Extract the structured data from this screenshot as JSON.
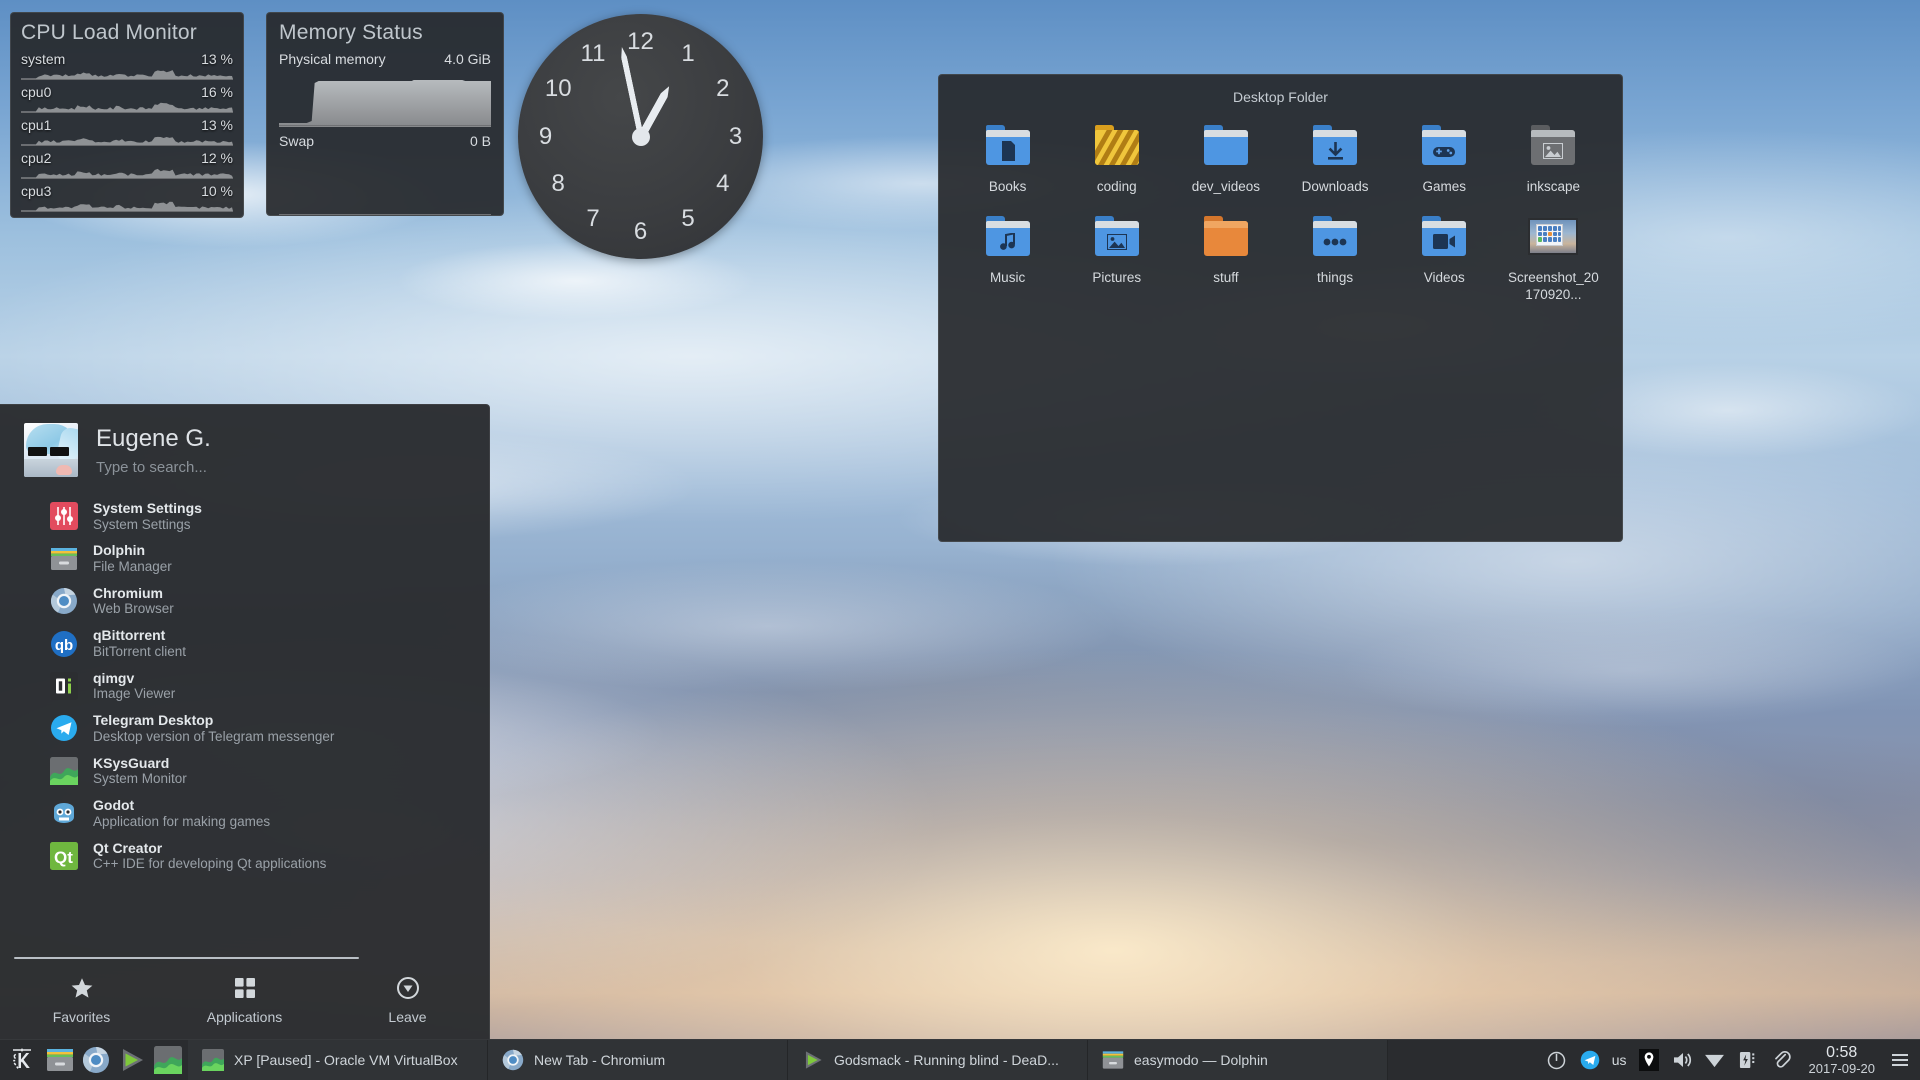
{
  "cpu_monitor": {
    "title": "CPU Load Monitor",
    "rows": [
      {
        "label": "system",
        "value": "13 %"
      },
      {
        "label": "cpu0",
        "value": "16 %"
      },
      {
        "label": "cpu1",
        "value": "13 %"
      },
      {
        "label": "cpu2",
        "value": "12 %"
      },
      {
        "label": "cpu3",
        "value": "10 %"
      }
    ]
  },
  "memory_status": {
    "title": "Memory Status",
    "physical_label": "Physical memory",
    "physical_value": "4.0 GiB",
    "swap_label": "Swap",
    "swap_value": "0 B"
  },
  "clock": {
    "numbers": [
      "12",
      "1",
      "2",
      "3",
      "4",
      "5",
      "6",
      "7",
      "8",
      "9",
      "10",
      "11"
    ],
    "hour": 0,
    "minute": 58
  },
  "desktop_folder": {
    "title": "Desktop Folder",
    "items": [
      {
        "name": "Books",
        "icon": "folder-book",
        "color": "#4e96e2"
      },
      {
        "name": "coding",
        "icon": "folder-coding",
        "color": "#e8b52b"
      },
      {
        "name": "dev_videos",
        "icon": "folder-plain",
        "color": "#4e96e2"
      },
      {
        "name": "Downloads",
        "icon": "folder-download",
        "color": "#4e96e2"
      },
      {
        "name": "Games",
        "icon": "folder-gamepad",
        "color": "#4e96e2"
      },
      {
        "name": "inkscape",
        "icon": "folder-image-grey",
        "color": "#6d6f72"
      },
      {
        "name": "Music",
        "icon": "folder-music",
        "color": "#4e96e2"
      },
      {
        "name": "Pictures",
        "icon": "folder-image",
        "color": "#4e96e2"
      },
      {
        "name": "stuff",
        "icon": "folder-orange",
        "color": "#e8883b"
      },
      {
        "name": "things",
        "icon": "folder-dots",
        "color": "#4e96e2"
      },
      {
        "name": "Videos",
        "icon": "folder-video",
        "color": "#4e96e2"
      },
      {
        "name": "Screenshot_20170920...",
        "icon": "image-thumbnail",
        "color": "#8aa4c0"
      }
    ]
  },
  "launcher": {
    "user_name": "Eugene G.",
    "search_placeholder": "Type to search...",
    "apps": [
      {
        "name": "System Settings",
        "desc": "System Settings",
        "icon": "system-settings-icon"
      },
      {
        "name": "Dolphin",
        "desc": "File Manager",
        "icon": "dolphin-icon"
      },
      {
        "name": "Chromium",
        "desc": "Web Browser",
        "icon": "chromium-icon"
      },
      {
        "name": "qBittorrent",
        "desc": "BitTorrent client",
        "icon": "qbittorrent-icon"
      },
      {
        "name": "qimgv",
        "desc": "Image Viewer",
        "icon": "qimgv-icon"
      },
      {
        "name": "Telegram Desktop",
        "desc": "Desktop version of Telegram messenger",
        "icon": "telegram-icon"
      },
      {
        "name": "KSysGuard",
        "desc": "System Monitor",
        "icon": "ksysguard-icon"
      },
      {
        "name": "Godot",
        "desc": "Application for making games",
        "icon": "godot-icon"
      },
      {
        "name": "Qt Creator",
        "desc": "C++ IDE for developing Qt applications",
        "icon": "qtcreator-icon"
      }
    ],
    "tabs": [
      {
        "label": "Favorites",
        "icon": "star-icon"
      },
      {
        "label": "Applications",
        "icon": "grid-icon"
      },
      {
        "label": "Leave",
        "icon": "power-circle-icon"
      }
    ]
  },
  "panel": {
    "kicker_icon": "kde-k-icon",
    "quick_launch": [
      {
        "icon": "dolphin-icon"
      },
      {
        "icon": "chromium-icon"
      },
      {
        "icon": "media-player-icon"
      },
      {
        "icon": "ksysguard-icon"
      }
    ],
    "tasks": [
      {
        "label": "XP [Paused] - Oracle VM VirtualBox",
        "icon": "ksysguard-icon"
      },
      {
        "label": "New Tab - Chromium",
        "icon": "chromium-icon"
      },
      {
        "label": "Godsmack - Running blind - DeaD...",
        "icon": "media-player-icon"
      },
      {
        "label": "easymodo — Dolphin",
        "icon": "dolphin-icon"
      }
    ],
    "tray": [
      {
        "icon": "power-icon",
        "label": ""
      },
      {
        "icon": "telegram-icon",
        "label": ""
      },
      {
        "icon": "keyboard-layout-icon",
        "label": "us"
      },
      {
        "icon": "location-pin-icon",
        "label": ""
      },
      {
        "icon": "volume-icon",
        "label": ""
      },
      {
        "icon": "network-icon",
        "label": ""
      },
      {
        "icon": "battery-icon",
        "label": ""
      },
      {
        "icon": "clipboard-icon",
        "label": ""
      }
    ],
    "clock_time": "0:58",
    "clock_date": "2017-09-20",
    "menu_icon": "hamburger-icon"
  },
  "colors": {
    "widget_bg": "#272a2c",
    "panel_bg": "#2a2c2f",
    "accent_blue": "#4e96e2",
    "text": "#d6dadd"
  }
}
